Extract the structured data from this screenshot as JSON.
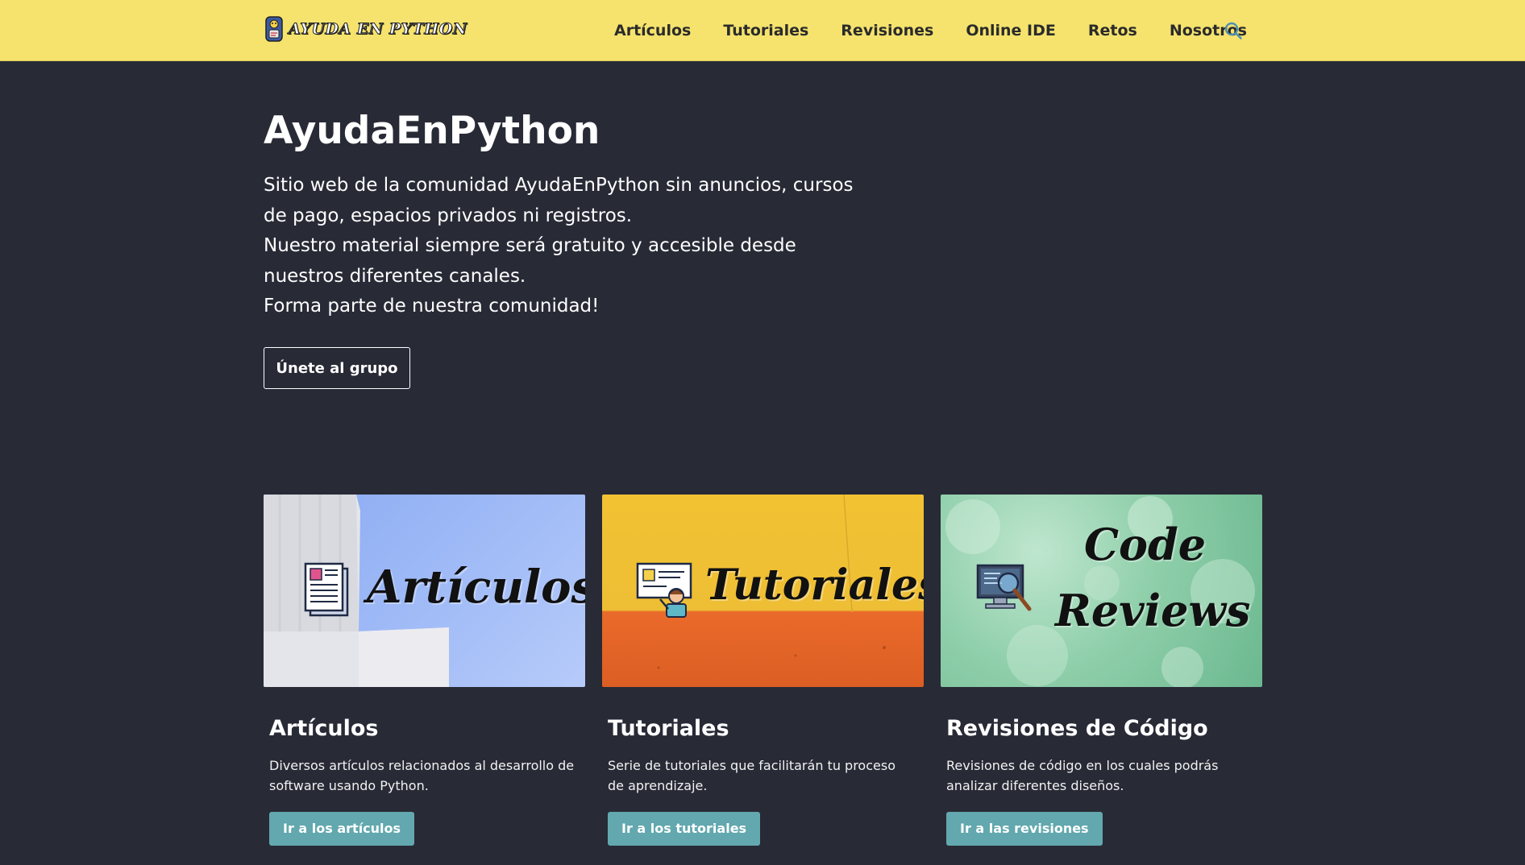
{
  "brand": {
    "name": "AYUDA EN PYTHON"
  },
  "nav": {
    "items": [
      {
        "label": "Artículos"
      },
      {
        "label": "Tutoriales"
      },
      {
        "label": "Revisiones"
      },
      {
        "label": "Online IDE"
      },
      {
        "label": "Retos"
      },
      {
        "label": "Nosotros"
      }
    ],
    "search_icon": "search-icon"
  },
  "hero": {
    "title": "AyudaEnPython",
    "lines": [
      "Sitio web de la comunidad AyudaEnPython sin anuncios, cursos de pago, espacios privados ni registros.",
      "Nuestro material siempre será gratuito y accesible desde nuestros diferentes canales.",
      "Forma parte de nuestra comunidad!"
    ],
    "button_label": "Únete al grupo"
  },
  "cards": [
    {
      "image_text": "Artículos",
      "title": "Artículos",
      "description": "Diversos artículos relacionados al desarrollo de software usando Python.",
      "button_label": "Ir a los artículos"
    },
    {
      "image_text": "Tutoriales",
      "title": "Tutoriales",
      "description": "Serie de tutoriales que facilitarán tu proceso de aprendizaje.",
      "button_label": "Ir a los tutoriales"
    },
    {
      "image_text_line1": "Code",
      "image_text_line2": "Reviews",
      "title": "Revisiones de Código",
      "description": "Revisiones de código en los cuales podrás analizar diferentes diseños.",
      "button_label": "Ir a las revisiones"
    }
  ],
  "colors": {
    "navbar": "#f5e36d",
    "background": "#282a36",
    "button_accent": "#62a8ae"
  }
}
